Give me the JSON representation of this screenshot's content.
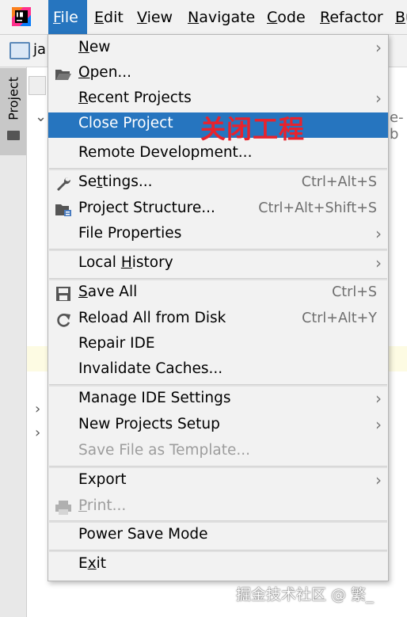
{
  "menubar": {
    "items": [
      {
        "pre": "",
        "m": "F",
        "post": "ile"
      },
      {
        "pre": "",
        "m": "E",
        "post": "dit"
      },
      {
        "pre": "",
        "m": "V",
        "post": "iew"
      },
      {
        "pre": "",
        "m": "N",
        "post": "avigate"
      },
      {
        "pre": "",
        "m": "C",
        "post": "ode"
      },
      {
        "pre": "",
        "m": "R",
        "post": "efactor"
      },
      {
        "pre": "",
        "m": "B",
        "post": "u"
      }
    ]
  },
  "background": {
    "file_tab_label": "ja",
    "project_tab_label": "Project",
    "cut_text": "e-b"
  },
  "menu": {
    "new": {
      "pre": "",
      "m": "N",
      "post": "ew"
    },
    "open": {
      "pre": "",
      "m": "O",
      "post": "pen..."
    },
    "recent_projects": {
      "pre": "",
      "m": "R",
      "post": "ecent Projects"
    },
    "close_project": "Close Project",
    "remote_development": "Remote Development...",
    "settings": {
      "pre": "Se",
      "m": "t",
      "post": "tings..."
    },
    "settings_shortcut": "Ctrl+Alt+S",
    "project_structure": "Project Structure...",
    "project_structure_shortcut": "Ctrl+Alt+Shift+S",
    "file_properties": "File Properties",
    "local_history": {
      "pre": "Local ",
      "m": "H",
      "post": "istory"
    },
    "save_all": {
      "pre": "",
      "m": "S",
      "post": "ave All"
    },
    "save_all_shortcut": "Ctrl+S",
    "reload_all": "Reload All from Disk",
    "reload_all_shortcut": "Ctrl+Alt+Y",
    "repair_ide": "Repair IDE",
    "invalidate_caches": "Invalidate Caches...",
    "manage_ide_settings": "Manage IDE Settings",
    "new_projects_setup": "New Projects Setup",
    "save_file_as_template": "Save File as Template...",
    "export": "Export",
    "print": {
      "pre": "",
      "m": "P",
      "post": "rint..."
    },
    "power_save_mode": "Power Save Mode",
    "exit": {
      "pre": "E",
      "m": "x",
      "post": "it"
    }
  },
  "annotation": "关闭工程",
  "watermark": "掘金技术社区 @ 繁_",
  "colors": {
    "highlight": "#2675bf",
    "annotation": "#e8232d"
  }
}
